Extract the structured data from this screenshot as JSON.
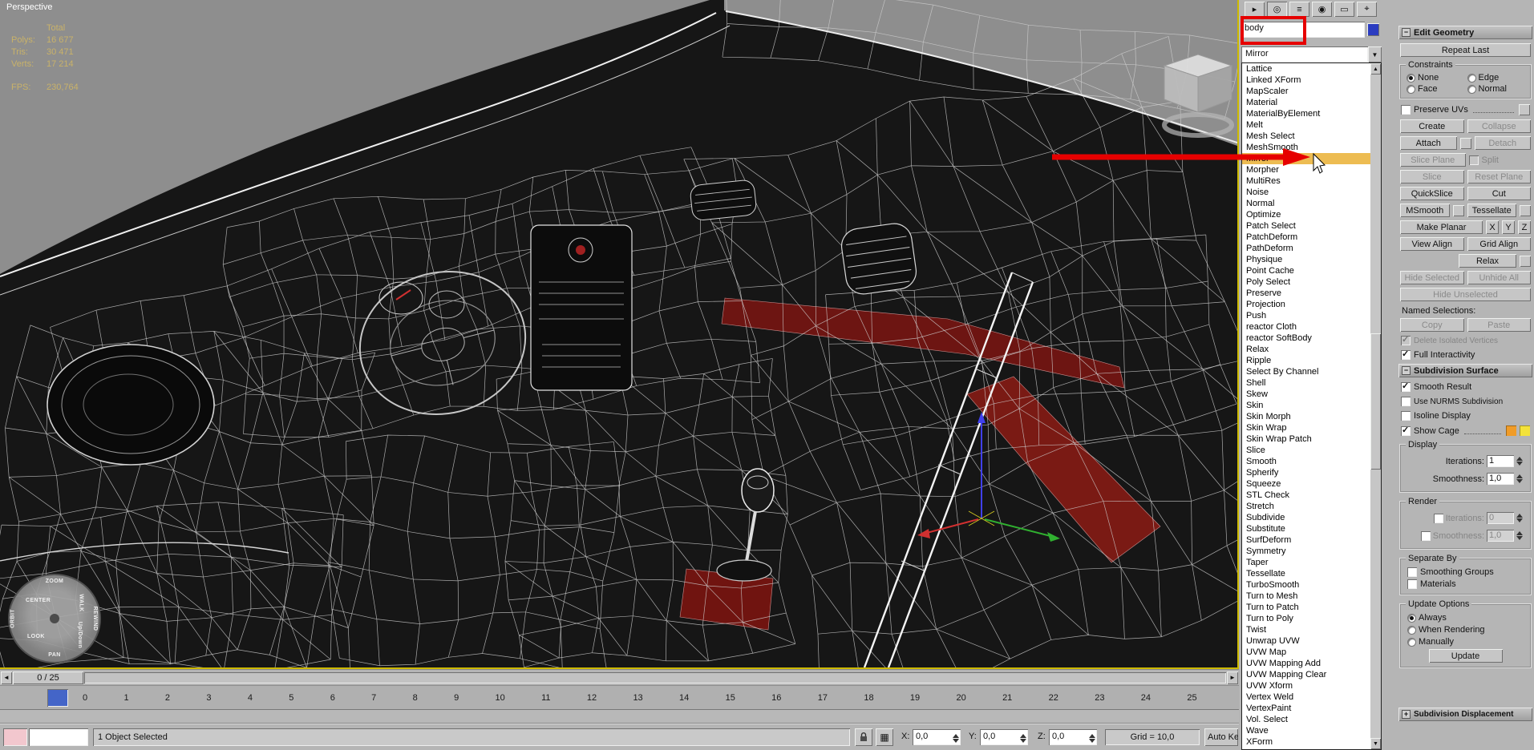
{
  "viewport": {
    "label": "Perspective",
    "stats": {
      "total_label": "Total",
      "polys_label": "Polys:",
      "polys": "16 677",
      "tris_label": "Tris:",
      "tris": "30 471",
      "verts_label": "Verts:",
      "verts": "17 214",
      "fps_label": "FPS:",
      "fps": "230,764"
    }
  },
  "nav_wheel": {
    "zoom": "ZOOM",
    "orbit": "ORBIT",
    "center": "CENTER",
    "walk": "WALK",
    "look": "LOOK",
    "up_down": "Up/Down",
    "rewind": "REWIND",
    "pan": "PAN"
  },
  "command_panel": {
    "tabs": [
      {
        "name": "create",
        "glyph": "▸"
      },
      {
        "name": "modify",
        "glyph": "◎"
      },
      {
        "name": "hierarchy",
        "glyph": "≡"
      },
      {
        "name": "motion",
        "glyph": "◉"
      },
      {
        "name": "display",
        "glyph": "▭"
      },
      {
        "name": "utilities",
        "glyph": "⌖"
      }
    ],
    "object_name": "body",
    "object_color": "#2b3cc0",
    "modifier_dropdown": {
      "selected": "Mirror",
      "highlighted": "Mirror",
      "highlight_color": "#edbc52",
      "items": [
        "Lattice",
        "Linked XForm",
        "MapScaler",
        "Material",
        "MaterialByElement",
        "Melt",
        "Mesh Select",
        "MeshSmooth",
        "Mirror",
        "Morpher",
        "MultiRes",
        "Noise",
        "Normal",
        "Optimize",
        "Patch Select",
        "PatchDeform",
        "PathDeform",
        "Physique",
        "Point Cache",
        "Poly Select",
        "Preserve",
        "Projection",
        "Push",
        "reactor Cloth",
        "reactor SoftBody",
        "Relax",
        "Ripple",
        "Select By Channel",
        "Shell",
        "Skew",
        "Skin",
        "Skin Morph",
        "Skin Wrap",
        "Skin Wrap Patch",
        "Slice",
        "Smooth",
        "Spherify",
        "Squeeze",
        "STL Check",
        "Stretch",
        "Subdivide",
        "Substitute",
        "SurfDeform",
        "Symmetry",
        "Taper",
        "Tessellate",
        "TurboSmooth",
        "Turn to Mesh",
        "Turn to Patch",
        "Turn to Poly",
        "Twist",
        "Unwrap UVW",
        "UVW Map",
        "UVW Mapping Add",
        "UVW Mapping Clear",
        "UVW Xform",
        "Vertex Weld",
        "VertexPaint",
        "Vol. Select",
        "Wave",
        "XForm"
      ]
    },
    "edit_geometry": {
      "title": "Edit Geometry",
      "repeat_last": "Repeat Last",
      "constraints_title": "Constraints",
      "constraint_none": "None",
      "constraint_edge": "Edge",
      "constraint_face": "Face",
      "constraint_normal": "Normal",
      "preserve_uvs": "Preserve UVs",
      "create": "Create",
      "collapse": "Collapse",
      "attach": "Attach",
      "detach": "Detach",
      "slice_plane": "Slice Plane",
      "split": "Split",
      "slice": "Slice",
      "reset_plane": "Reset Plane",
      "quickslice": "QuickSlice",
      "cut": "Cut",
      "msmooth": "MSmooth",
      "tessellate": "Tessellate",
      "make_planar": "Make Planar",
      "axis_x": "X",
      "axis_y": "Y",
      "axis_z": "Z",
      "view_align": "View Align",
      "grid_align": "Grid Align",
      "relax": "Relax",
      "hide_selected": "Hide Selected",
      "unhide_all": "Unhide All",
      "hide_unselected": "Hide Unselected",
      "named_selections": "Named Selections:",
      "copy": "Copy",
      "paste": "Paste",
      "delete_isolated_vertices": "Delete Isolated Vertices",
      "full_interactivity": "Full Interactivity"
    },
    "subdivision_surface": {
      "title": "Subdivision Surface",
      "smooth_result": "Smooth Result",
      "use_nurms": "Use NURMS Subdivision",
      "isoline_display": "Isoline Display",
      "show_cage": "Show Cage",
      "cage_color": "#f09c28",
      "cage_selected_color": "#f3e23a",
      "display_title": "Display",
      "iterations_label": "Iterations:",
      "smoothness_label": "Smoothness:",
      "display_iterations": "1",
      "display_smoothness": "1,0",
      "render_title": "Render",
      "render_iterations": "0",
      "render_smoothness": "1,0",
      "separate_by_title": "Separate By",
      "smoothing_groups": "Smoothing Groups",
      "materials": "Materials",
      "update_options_title": "Update Options",
      "always": "Always",
      "when_rendering": "When Rendering",
      "manually": "Manually",
      "update": "Update"
    },
    "subdivision_displacement_title": "Subdivision Displacement"
  },
  "timeline": {
    "time_display": "0 / 25",
    "prev_arrow": "◄",
    "next_arrow": "►",
    "ticks": [
      "0",
      "1",
      "2",
      "3",
      "4",
      "5",
      "6",
      "7",
      "8",
      "9",
      "10",
      "11",
      "12",
      "13",
      "14",
      "15",
      "16",
      "17",
      "18",
      "19",
      "20",
      "21",
      "22",
      "23",
      "24",
      "25"
    ]
  },
  "status_bar": {
    "selection_status": "1 Object Selected",
    "absrel_glyph": "▦",
    "x_label": "X:",
    "x_value": "0,0",
    "y_label": "Y:",
    "y_value": "0,0",
    "z_label": "Z:",
    "z_value": "0,0",
    "grid_display": "Grid = 10,0",
    "auto_key": "Auto Key",
    "playback": {
      "go_start": "◄◄",
      "prev": "◄",
      "play": "►",
      "next": "►",
      "go_end": "►►"
    },
    "nav": {
      "zoom": "⊕",
      "pan": "↔",
      "orbit": "↻",
      "maximize": "▣"
    }
  },
  "annotation": {
    "color": "#e60000"
  }
}
